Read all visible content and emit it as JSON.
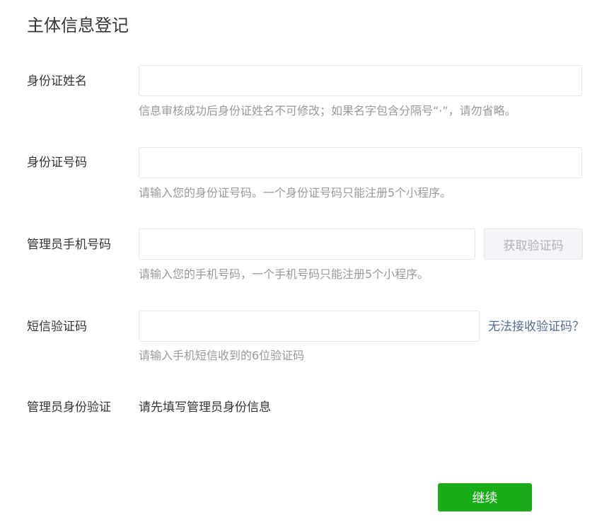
{
  "page": {
    "title": "主体信息登记"
  },
  "form": {
    "id_name": {
      "label": "身份证姓名",
      "value": "",
      "hint": "信息审核成功后身份证姓名不可修改；如果名字包含分隔号“·”，请勿省略。"
    },
    "id_number": {
      "label": "身份证号码",
      "value": "",
      "hint": "请输入您的身份证号码。一个身份证号码只能注册5个小程序。"
    },
    "admin_phone": {
      "label": "管理员手机号码",
      "value": "",
      "hint": "请输入您的手机号码，一个手机号码只能注册5个小程序。",
      "get_code_label": "获取验证码"
    },
    "sms_code": {
      "label": "短信验证码",
      "value": "",
      "hint": "请输入手机短信收到的6位验证码",
      "help_link": "无法接收验证码？"
    },
    "admin_verify": {
      "label": "管理员身份验证",
      "text": "请先填写管理员身份信息"
    }
  },
  "actions": {
    "continue_label": "继续"
  },
  "colors": {
    "primary_green": "#1aad19",
    "link_blue": "#576b95",
    "hint_gray": "#9a9a9a",
    "border": "#e7e7eb"
  }
}
